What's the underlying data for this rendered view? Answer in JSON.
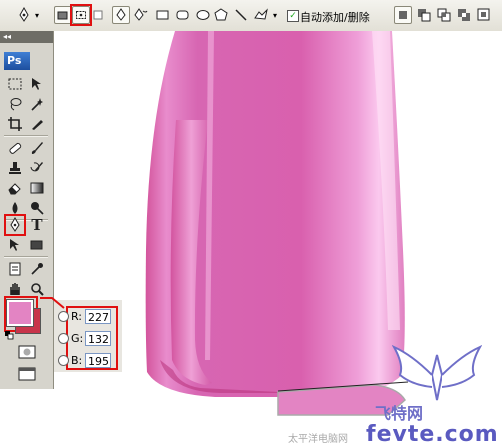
{
  "options_bar": {
    "auto_add_delete_label": "自动添加/删除",
    "auto_add_delete_checked": true,
    "highlighted_option": "paths-mode"
  },
  "toolbox": {
    "logo": "Ps",
    "header_glyph": "◂◂",
    "highlighted_tool": "pen-tool"
  },
  "colors": {
    "foreground_hex": "#E384C3",
    "background_hex": "#C8344A",
    "canvas_fill_hex": "#E384C3"
  },
  "color_panel": {
    "r_label": "R:",
    "r_value": "227",
    "g_label": "G:",
    "g_value": "132",
    "b_label": "B:",
    "b_value": "195"
  },
  "watermark": {
    "line1": "飞特网",
    "line2": "fevte.com",
    "line3": "太平洋电脑网"
  }
}
